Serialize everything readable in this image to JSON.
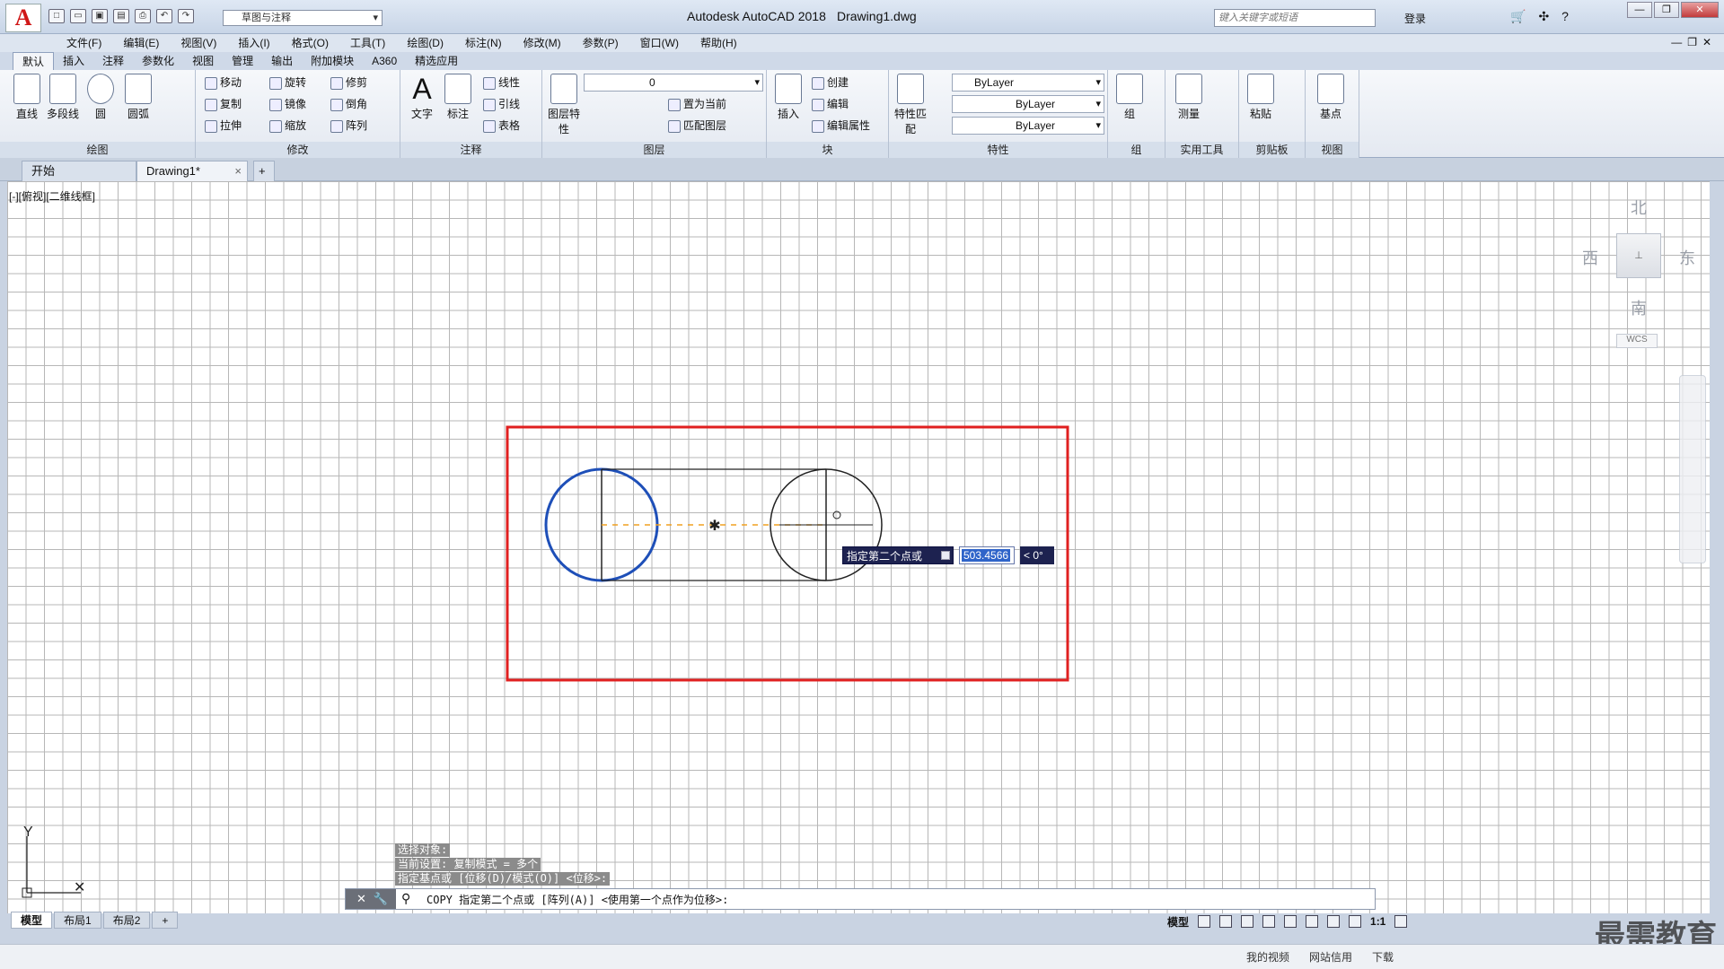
{
  "titlebar": {
    "app_title": "Autodesk AutoCAD 2018",
    "file_name": "Drawing1.dwg",
    "workspace": "草图与注释",
    "search_placeholder": "键入关键字或短语",
    "login": "登录"
  },
  "menu": [
    "文件(F)",
    "编辑(E)",
    "视图(V)",
    "插入(I)",
    "格式(O)",
    "工具(T)",
    "绘图(D)",
    "标注(N)",
    "修改(M)",
    "参数(P)",
    "窗口(W)",
    "帮助(H)"
  ],
  "ribbon_tabs": [
    "默认",
    "插入",
    "注释",
    "参数化",
    "视图",
    "管理",
    "输出",
    "附加模块",
    "A360",
    "精选应用"
  ],
  "ribbon": {
    "draw": {
      "title": "绘图",
      "line": "直线",
      "polyline": "多段线",
      "circle": "圆",
      "arc": "圆弧"
    },
    "modify": {
      "title": "修改",
      "move": "移动",
      "rotate": "旋转",
      "trim": "修剪",
      "copy": "复制",
      "mirror": "镜像",
      "fillet": "倒角",
      "stretch": "拉伸",
      "scale": "缩放",
      "array": "阵列"
    },
    "annotation": {
      "title": "注释",
      "text": "文字",
      "dimension": "标注",
      "linear": "线性",
      "leader": "引线",
      "table": "表格"
    },
    "layers": {
      "title": "图层",
      "layer_props": "图层特性",
      "current_layer": "0",
      "set_current": "置为当前",
      "match_layer": "匹配图层"
    },
    "block": {
      "title": "块",
      "insert": "插入",
      "create": "创建",
      "edit": "编辑",
      "edit_attr": "编辑属性"
    },
    "properties": {
      "title": "特性",
      "match": "特性匹配",
      "color": "ByLayer",
      "linetype": "ByLayer",
      "lineweight": "ByLayer"
    },
    "groups": {
      "title": "组",
      "group": "组"
    },
    "utilities": {
      "title": "实用工具",
      "measure": "测量"
    },
    "clipboard": {
      "title": "剪贴板",
      "paste": "粘贴"
    },
    "view": {
      "title": "视图",
      "base": "基点"
    }
  },
  "file_tabs": {
    "start": "开始",
    "drawing": "Drawing1*"
  },
  "viewport_label": "[-][俯视][二维线框]",
  "viewcube": {
    "north": "北",
    "south": "南",
    "east": "东",
    "west": "西",
    "wcs": "WCS"
  },
  "dynamic_input": {
    "prompt": "指定第二个点或",
    "value": "503.4566",
    "angle": "< 0°"
  },
  "command": {
    "history": [
      "选择对象:",
      "当前设置:  复制模式 = 多个",
      "指定基点或 [位移(D)/模式(O)] <位移>:"
    ],
    "current": "COPY 指定第二个点或 [阵列(A)] <使用第一个点作为位移>:"
  },
  "layout_tabs": [
    "模型",
    "布局1",
    "布局2"
  ],
  "status": {
    "model": "模型",
    "scale": "1:1"
  },
  "bottom_links": [
    "我的视频",
    "网站信用",
    "下载"
  ],
  "watermark": "最需教育",
  "colors": {
    "selection_rect": "#e02020",
    "circle_highlight": "#1e4fb8",
    "dash_line": "#f0a020"
  }
}
